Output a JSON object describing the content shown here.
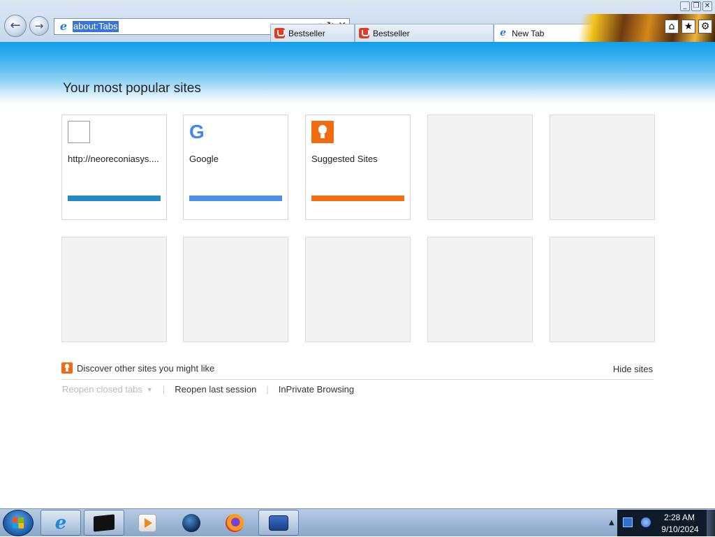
{
  "browser": {
    "window_buttons": [
      "_",
      "❐",
      "✕"
    ],
    "address": {
      "value": "about:Tabs",
      "tools": [
        "⌕",
        "▾",
        "↻",
        "✕"
      ]
    },
    "tabs": [
      {
        "label": "Bestseller",
        "favicon": "bag-icon"
      },
      {
        "label": "Bestseller",
        "favicon": "bag-icon"
      },
      {
        "label": "New Tab",
        "favicon": "ie-icon",
        "close": "✕"
      }
    ],
    "toolbar": {
      "home": "⌂",
      "favorites": "★",
      "tools": "⚙"
    }
  },
  "new_tab_page": {
    "title": "Your most popular sites",
    "tiles": [
      {
        "label": "http://neoreconiasys....",
        "icon": "blank-page-icon",
        "bar_color": "#1f8ac3"
      },
      {
        "label": "Google",
        "icon": "google-icon",
        "icon_glyph": "G",
        "bar_color": "#4d8ee8"
      },
      {
        "label": "Suggested Sites",
        "icon": "lightbulb-icon",
        "bar_color": "#f36f12"
      },
      {
        "label": ""
      },
      {
        "label": ""
      },
      {
        "label": ""
      },
      {
        "label": ""
      },
      {
        "label": ""
      },
      {
        "label": ""
      },
      {
        "label": ""
      }
    ],
    "discover_text": "Discover other sites you might like",
    "hide_sites": "Hide sites",
    "links": {
      "reopen_closed_tabs": "Reopen closed tabs",
      "reopen_last_session": "Reopen last session",
      "inprivate_browsing": "InPrivate Browsing"
    }
  },
  "taskbar": {
    "apps": [
      "internet-explorer",
      "terminal",
      "media-player",
      "globe",
      "firefox",
      "network"
    ],
    "clock": {
      "time": "2:28 AM",
      "date": "9/10/2024"
    }
  },
  "colors": {
    "page_header_blue": "#12a0e8",
    "selection_blue": "#3875d7",
    "accent_orange": "#f26b0f"
  }
}
